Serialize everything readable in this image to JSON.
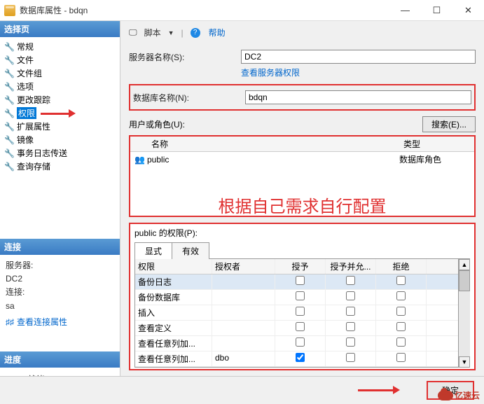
{
  "window": {
    "title": "数据库属性 - bdqn"
  },
  "winbtns": {
    "min": "—",
    "max": "☐",
    "close": "✕"
  },
  "left": {
    "selectPage": "选择页",
    "items": [
      "常规",
      "文件",
      "文件组",
      "选项",
      "更改跟踪",
      "权限",
      "扩展属性",
      "镜像",
      "事务日志传送",
      "查询存储"
    ],
    "connection": "连接",
    "serverLbl": "服务器:",
    "serverVal": "DC2",
    "connLbl": "连接:",
    "connVal": "sa",
    "viewConnProps": "查看连接属性",
    "progress": "进度",
    "ready": "就绪"
  },
  "toolbar": {
    "script": "脚本",
    "help": "帮助"
  },
  "fields": {
    "serverNameLbl": "服务器名称(S):",
    "serverNameVal": "DC2",
    "viewServerPerm": "查看服务器权限",
    "dbNameLbl": "数据库名称(N):",
    "dbNameVal": "bdqn",
    "usersLbl": "用户或角色(U):",
    "searchBtn": "搜索(E)..."
  },
  "userGrid": {
    "colName": "名称",
    "colType": "类型",
    "rows": [
      {
        "name": "public",
        "type": "数据库角色"
      }
    ]
  },
  "overlay": "根据自己需求自行配置",
  "perm": {
    "title": "public 的权限(P):",
    "tabExplicit": "显式",
    "tabEffective": "有效",
    "cols": {
      "perm": "权限",
      "grantor": "授权者",
      "grant": "授予",
      "wgrant": "授予并允...",
      "deny": "拒绝"
    },
    "rows": [
      {
        "perm": "备份日志",
        "grantor": "",
        "grant": false,
        "wgrant": false,
        "deny": false,
        "highlight": true
      },
      {
        "perm": "备份数据库",
        "grantor": "",
        "grant": false,
        "wgrant": false,
        "deny": false
      },
      {
        "perm": "插入",
        "grantor": "",
        "grant": false,
        "wgrant": false,
        "deny": false
      },
      {
        "perm": "查看定义",
        "grantor": "",
        "grant": false,
        "wgrant": false,
        "deny": false
      },
      {
        "perm": "查看任意列加...",
        "grantor": "",
        "grant": false,
        "wgrant": false,
        "deny": false
      },
      {
        "perm": "查看任意列加...",
        "grantor": "dbo",
        "grant": true,
        "wgrant": false,
        "deny": false
      }
    ]
  },
  "footer": {
    "ok": "确定",
    "cancel": ""
  },
  "watermark": "亿速云"
}
